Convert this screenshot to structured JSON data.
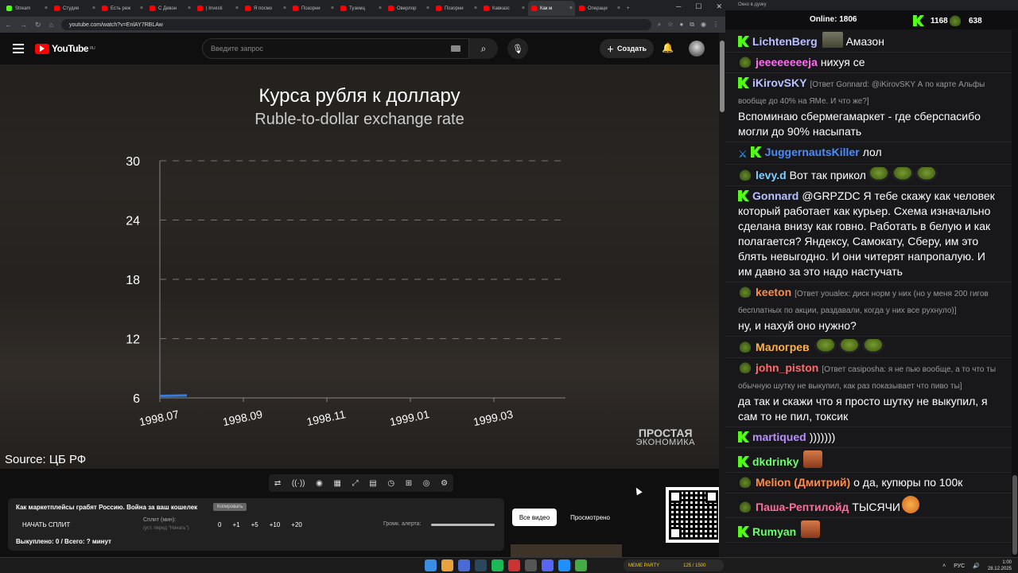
{
  "browser": {
    "tabs": [
      {
        "label": "Stream",
        "color": "#53fc18"
      },
      {
        "label": "Студия",
        "color": "#f00"
      },
      {
        "label": "Есть реж",
        "color": "#f00"
      },
      {
        "label": "С Девон",
        "color": "#f00"
      },
      {
        "label": "| Investi",
        "color": "#f00"
      },
      {
        "label": "Я посмо",
        "color": "#f00"
      },
      {
        "label": "Позорни",
        "color": "#f00"
      },
      {
        "label": "Туземц",
        "color": "#f00"
      },
      {
        "label": "Оверлор",
        "color": "#f00"
      },
      {
        "label": "Позорни",
        "color": "#f00"
      },
      {
        "label": "Кавказс",
        "color": "#f00"
      },
      {
        "label": "Как м",
        "color": "#f00"
      },
      {
        "label": "Операци",
        "color": "#f00"
      }
    ],
    "active_tab_index": 11,
    "url": "youtube.com/watch?v=EnlAY7RBLAw"
  },
  "youtube": {
    "logo_text": "YouTube",
    "region": "RU",
    "search_placeholder": "Введите запрос",
    "create_label": "Создать"
  },
  "video": {
    "title_ru": "Курса рубля к доллару",
    "title_en": "Ruble-to-dollar exchange rate",
    "source": "Source: ЦБ РФ",
    "brand_line1": "ПРОСТАЯ",
    "brand_line2": "ЭКОНОМИКА"
  },
  "chart_data": {
    "type": "line",
    "title": "Курса рубля к доллару",
    "subtitle": "Ruble-to-dollar exchange rate",
    "x_ticks": [
      "1998.07",
      "1998.09",
      "1998.11",
      "1999.01",
      "1999.03"
    ],
    "y_ticks": [
      6,
      12,
      18,
      24,
      30
    ],
    "ylim": [
      6,
      30
    ],
    "grid": true,
    "series": [
      {
        "x": [
          "1998.07",
          "1998.07"
        ],
        "values": [
          6.2,
          6.25
        ],
        "color": "#3a7bd5"
      }
    ]
  },
  "toolbar": {
    "icons": [
      "loop-icon",
      "broadcast-icon",
      "eye-icon",
      "clapper-icon",
      "resize-icon",
      "frames-icon",
      "speed-icon",
      "add-screen-icon",
      "camera-icon",
      "settings-icon"
    ]
  },
  "panel": {
    "title": "Как маркетплейсы грабят Россию. Война за ваш кошелек",
    "copy_label": "Копировать",
    "split_button": "НАЧАТЬ СПЛИТ",
    "split_label": "Сплит (мин):",
    "split_note": "(уст. перед \"Начать\")",
    "nums": [
      "0",
      "+1",
      "+5",
      "+10",
      "+20"
    ],
    "volume_label": "Громк. алерта:",
    "bought": "Выкуплено: 0 / Всего: ? минут",
    "btn_all": "Все видео",
    "btn_watched": "Просмотрено"
  },
  "chat": {
    "window_title": "Окно в дуэку",
    "online_label": "Online:",
    "online_count": "1806",
    "kick_count": "1168",
    "other_count": "638",
    "messages": [
      {
        "badge": "k",
        "user": "LichtenBerg",
        "color": "#b9c1ff",
        "text": "Амазон",
        "emote": "photo"
      },
      {
        "badge": "pepe",
        "user": "jeeeeeeeeja",
        "color": "#ff6bf1",
        "text": "нихуя се"
      },
      {
        "badge": "k",
        "user": "iKirovSKY",
        "color": "#b9c1ff",
        "reply": "[Ответ Gonnard: @iKirovSKY А по карте Альфы вообще до 40% на ЯМе. И что же?]",
        "text": "Вспоминаю сбермегамаркет - где сберспасибо могли до 90% насыпать"
      },
      {
        "badge": "sword",
        "badge2": "k",
        "user": "JuggernautsKiller",
        "color": "#4a8cff",
        "text": "лол"
      },
      {
        "badge": "pepe",
        "user": "levy.d",
        "color": "#7fd0ff",
        "text": "Вот так прикол",
        "emotes": 3
      },
      {
        "badge": "k",
        "user": "Gonnard",
        "color": "#b9c1ff",
        "text": "@GRPZDC Я тебе скажу как человек который работает как курьер. Схема изначально сделана внизу как говно. Работать в белую и как полагается? Яндексу, Самокату, Сберу, им это блять невыгодно. И они читерят напропалую. И им давно за это надо настучать"
      },
      {
        "badge": "pepe",
        "user": "keeton",
        "color": "#ff8c4a",
        "reply": "[Ответ youalex: диск норм у них (но у меня 200 гигов бесплатных по акции, раздавали, когда у них все рухнуло)]",
        "text": "ну, и нахуй оно нужно?"
      },
      {
        "badge": "pepe",
        "user": "Малогрев",
        "color": "#ffb347",
        "text": "",
        "emotes": 3
      },
      {
        "badge": "pepe",
        "user": "john_piston",
        "color": "#ff6b6b",
        "reply": "[Ответ casiposha: я не пью вообще, а то что ты обычную шутку не выкупил, как раз показывает что пиво ты]",
        "text": "да так и скажи что я просто шутку не выкупил, я сам то не пил, токсик"
      },
      {
        "badge": "k",
        "user": "martiqued",
        "color": "#b98cff",
        "text": ")))))))"
      },
      {
        "badge": "k",
        "user": "dkdrinky",
        "color": "#6bff6b",
        "text": "",
        "emote": "face"
      },
      {
        "badge": "pepe",
        "user": "Melion (Дмитрий)",
        "color": "#ff8c4a",
        "text": "о да, купюры по 100к"
      },
      {
        "badge": "pepe",
        "user": "Паша-Рептилойд",
        "color": "#ff6b9a",
        "text": "ТЫСЯЧИ",
        "emote": "heart"
      },
      {
        "badge": "k",
        "user": "Rumyan",
        "color": "#6bff6b",
        "text": "",
        "emote": "face"
      }
    ]
  },
  "taskbar": {
    "meme_label": "MEME PARTY",
    "meme_count": "125 / 1500",
    "lang": "РУС",
    "time": "1:00",
    "date": "28.12.2025"
  }
}
